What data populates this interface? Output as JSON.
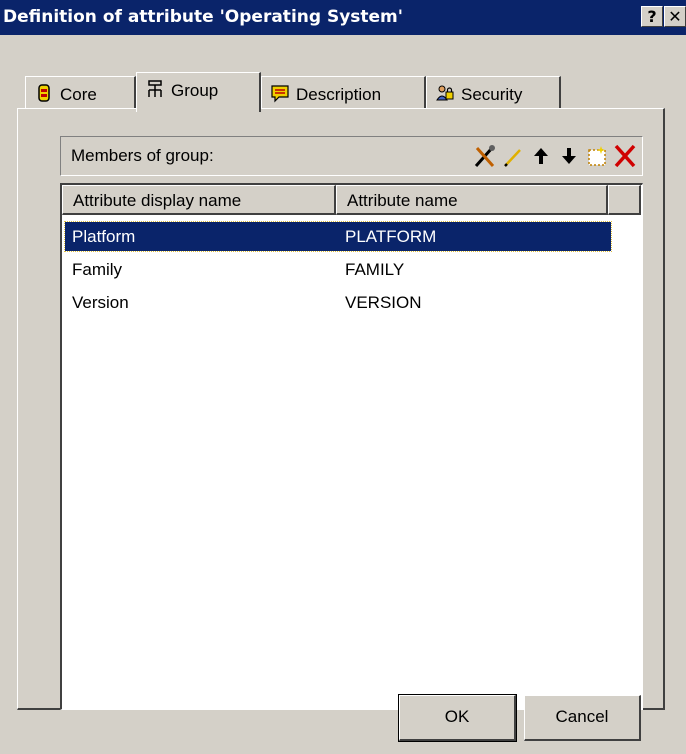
{
  "window": {
    "title": "Definition of attribute 'Operating System'",
    "help_label": "?",
    "close_label": "✕"
  },
  "tabs": [
    {
      "label": "Core",
      "icon": "core-icon"
    },
    {
      "label": "Group",
      "icon": "group-icon",
      "active": true
    },
    {
      "label": "Description",
      "icon": "description-icon"
    },
    {
      "label": "Security",
      "icon": "security-icon"
    }
  ],
  "members": {
    "label": "Members of group:",
    "toolbar_icons": [
      "tools-icon",
      "edit-icon",
      "move-up-icon",
      "move-down-icon",
      "new-icon",
      "delete-icon"
    ]
  },
  "table": {
    "columns": [
      "Attribute display name",
      "Attribute name"
    ],
    "rows": [
      {
        "display": "Platform",
        "name": "PLATFORM",
        "selected": true
      },
      {
        "display": "Family",
        "name": "FAMILY"
      },
      {
        "display": "Version",
        "name": "VERSION"
      }
    ]
  },
  "buttons": {
    "ok": "OK",
    "cancel": "Cancel"
  },
  "colors": {
    "titlebar": "#0a246a",
    "face": "#d4d0c8",
    "selection": "#0a246a"
  }
}
